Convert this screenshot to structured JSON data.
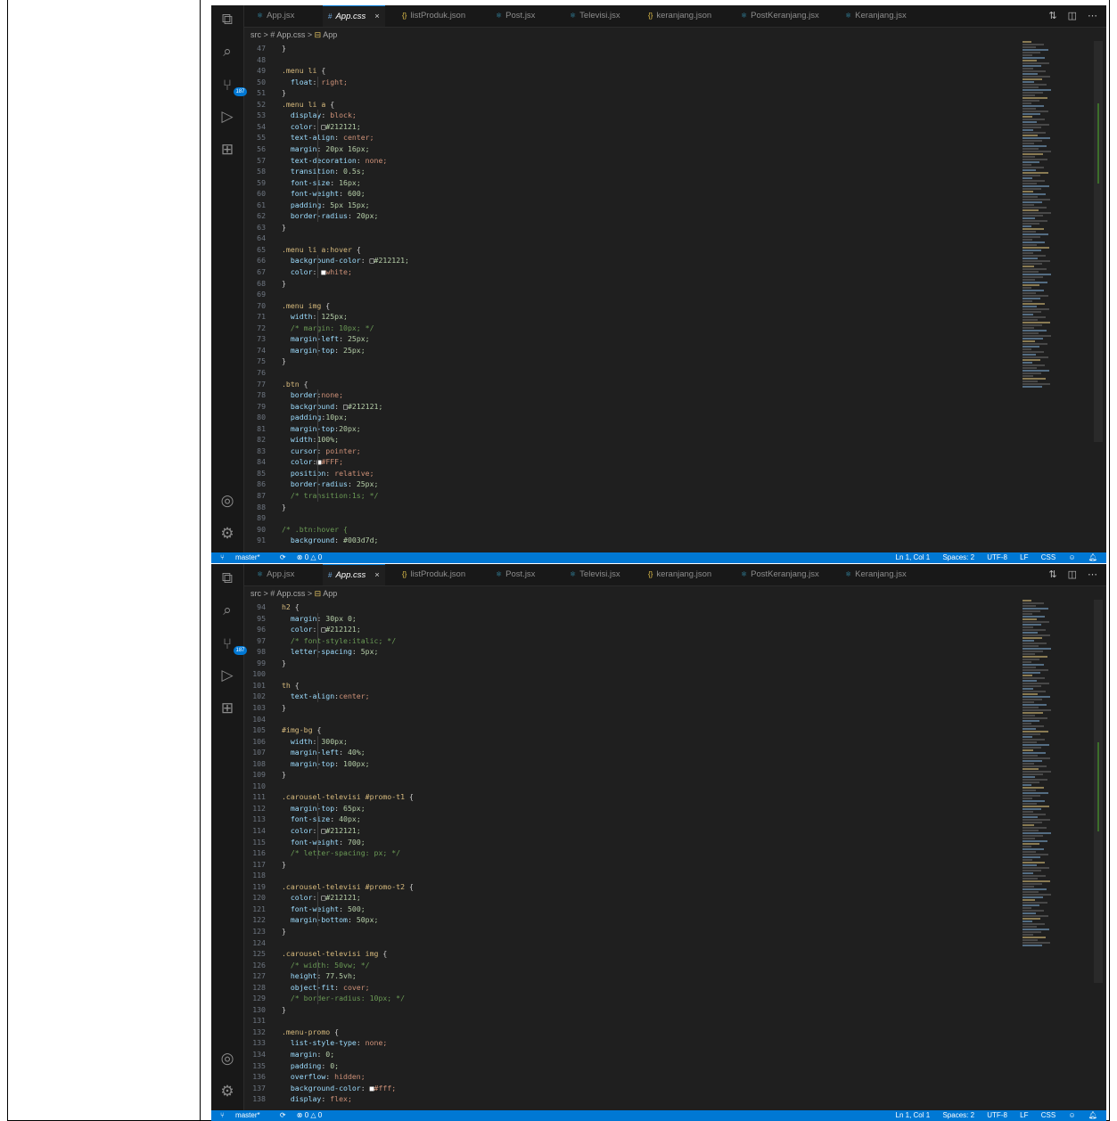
{
  "tabs": [
    {
      "icon": "react-icon",
      "label": "App.jsx",
      "active": false
    },
    {
      "icon": "css-hash-icon",
      "label": "App.css",
      "active": true
    },
    {
      "icon": "json-braces-icon",
      "label": "listProduk.json",
      "active": false
    },
    {
      "icon": "react-icon",
      "label": "Post.jsx",
      "active": false
    },
    {
      "icon": "react-icon",
      "label": "Televisi.jsx",
      "active": false
    },
    {
      "icon": "json-braces-icon",
      "label": "keranjang.json",
      "active": false
    },
    {
      "icon": "react-icon",
      "label": "PostKeranjang.jsx",
      "active": false
    },
    {
      "icon": "react-icon",
      "label": "Keranjang.jsx",
      "active": false
    }
  ],
  "tab_close_glyph": "×",
  "breadcrumb": {
    "folder": "src",
    "file": "App.css",
    "symbol": "App",
    "separator": ">"
  },
  "activity_badge": "187",
  "statusbar": {
    "branch": "master*",
    "errors": "⊗ 0 △ 0",
    "position": "Ln 1, Col 1",
    "spaces": "Spaces: 2",
    "encoding": "UTF-8",
    "eol": "LF",
    "language": "CSS"
  },
  "colors": {
    "editor_bg": "#1f1f1f",
    "statusbar_bg": "#0078d4",
    "selector": "#d7ba7d",
    "property": "#9cdcfe",
    "value": "#ce9178",
    "number": "#b5cea8",
    "comment": "#6a9955"
  },
  "code_top": [
    {
      "n": "47",
      "t": "}"
    },
    {
      "n": "48",
      "t": ""
    },
    {
      "n": "49",
      "t": ".menu li {"
    },
    {
      "n": "50",
      "t": "  float: right;"
    },
    {
      "n": "51",
      "t": "}"
    },
    {
      "n": "52",
      "t": ".menu li a {"
    },
    {
      "n": "53",
      "t": "  display: block;"
    },
    {
      "n": "54",
      "t": "  color: □#212121;"
    },
    {
      "n": "55",
      "t": "  text-align: center;"
    },
    {
      "n": "56",
      "t": "  margin: 20px 16px;"
    },
    {
      "n": "57",
      "t": "  text-decoration: none;"
    },
    {
      "n": "58",
      "t": "  transition: 0.5s;"
    },
    {
      "n": "59",
      "t": "  font-size: 16px;"
    },
    {
      "n": "60",
      "t": "  font-weight: 600;"
    },
    {
      "n": "61",
      "t": "  padding: 5px 15px;"
    },
    {
      "n": "62",
      "t": "  border-radius: 20px;"
    },
    {
      "n": "63",
      "t": "}"
    },
    {
      "n": "64",
      "t": ""
    },
    {
      "n": "65",
      "t": ".menu li a:hover {"
    },
    {
      "n": "66",
      "t": "  background-color: □#212121;"
    },
    {
      "n": "67",
      "t": "  color: ■white;"
    },
    {
      "n": "68",
      "t": "}"
    },
    {
      "n": "69",
      "t": ""
    },
    {
      "n": "70",
      "t": ".menu img {"
    },
    {
      "n": "71",
      "t": "  width: 125px;"
    },
    {
      "n": "72",
      "t": "  /* margin: 10px; */"
    },
    {
      "n": "73",
      "t": "  margin-left: 25px;"
    },
    {
      "n": "74",
      "t": "  margin-top: 25px;"
    },
    {
      "n": "75",
      "t": "}"
    },
    {
      "n": "76",
      "t": ""
    },
    {
      "n": "77",
      "t": ".btn {"
    },
    {
      "n": "78",
      "t": "  border:none;"
    },
    {
      "n": "79",
      "t": "  background: □#212121;"
    },
    {
      "n": "80",
      "t": "  padding:10px;"
    },
    {
      "n": "81",
      "t": "  margin-top:20px;"
    },
    {
      "n": "82",
      "t": "  width:100%;"
    },
    {
      "n": "83",
      "t": "  cursor: pointer;"
    },
    {
      "n": "84",
      "t": "  color:■#FFF;"
    },
    {
      "n": "85",
      "t": "  position: relative;"
    },
    {
      "n": "86",
      "t": "  border-radius: 25px;"
    },
    {
      "n": "87",
      "t": "  /* transition:1s; */"
    },
    {
      "n": "88",
      "t": "}"
    },
    {
      "n": "89",
      "t": ""
    },
    {
      "n": "90",
      "t": "/* .btn:hover {"
    },
    {
      "n": "91",
      "t": "  background: #003d7d;"
    }
  ],
  "code_bottom": [
    {
      "n": "94",
      "t": "h2 {"
    },
    {
      "n": "95",
      "t": "  margin: 30px 0;"
    },
    {
      "n": "96",
      "t": "  color: □#212121;"
    },
    {
      "n": "97",
      "t": "  /* font-style:italic; */"
    },
    {
      "n": "98",
      "t": "  letter-spacing: 5px;"
    },
    {
      "n": "99",
      "t": "}"
    },
    {
      "n": "100",
      "t": ""
    },
    {
      "n": "101",
      "t": "th {"
    },
    {
      "n": "102",
      "t": "  text-align:center;"
    },
    {
      "n": "103",
      "t": "}"
    },
    {
      "n": "104",
      "t": ""
    },
    {
      "n": "105",
      "t": "#img-bg {"
    },
    {
      "n": "106",
      "t": "  width: 300px;"
    },
    {
      "n": "107",
      "t": "  margin-left: 40%;"
    },
    {
      "n": "108",
      "t": "  margin-top: 100px;"
    },
    {
      "n": "109",
      "t": "}"
    },
    {
      "n": "110",
      "t": ""
    },
    {
      "n": "111",
      "t": ".carousel-televisi #promo-t1 {"
    },
    {
      "n": "112",
      "t": "  margin-top: 65px;"
    },
    {
      "n": "113",
      "t": "  font-size: 40px;"
    },
    {
      "n": "114",
      "t": "  color: □#212121;"
    },
    {
      "n": "115",
      "t": "  font-weight: 700;"
    },
    {
      "n": "116",
      "t": "  /* letter-spacing: px; */"
    },
    {
      "n": "117",
      "t": "}"
    },
    {
      "n": "118",
      "t": ""
    },
    {
      "n": "119",
      "t": ".carousel-televisi #promo-t2 {"
    },
    {
      "n": "120",
      "t": "  color: □#212121;"
    },
    {
      "n": "121",
      "t": "  font-weight: 500;"
    },
    {
      "n": "122",
      "t": "  margin-bottom: 50px;"
    },
    {
      "n": "123",
      "t": "}"
    },
    {
      "n": "124",
      "t": ""
    },
    {
      "n": "125",
      "t": ".carousel-televisi img {"
    },
    {
      "n": "126",
      "t": "  /* width: 50vw; */"
    },
    {
      "n": "127",
      "t": "  height: 77.5vh;"
    },
    {
      "n": "128",
      "t": "  object-fit: cover;"
    },
    {
      "n": "129",
      "t": "  /* border-radius: 10px; */"
    },
    {
      "n": "130",
      "t": "}"
    },
    {
      "n": "131",
      "t": ""
    },
    {
      "n": "132",
      "t": ".menu-promo {"
    },
    {
      "n": "133",
      "t": "  list-style-type: none;"
    },
    {
      "n": "134",
      "t": "  margin: 0;"
    },
    {
      "n": "135",
      "t": "  padding: 0;"
    },
    {
      "n": "136",
      "t": "  overflow: hidden;"
    },
    {
      "n": "137",
      "t": "  background-color: ■#fff;"
    },
    {
      "n": "138",
      "t": "  display: flex;"
    }
  ]
}
